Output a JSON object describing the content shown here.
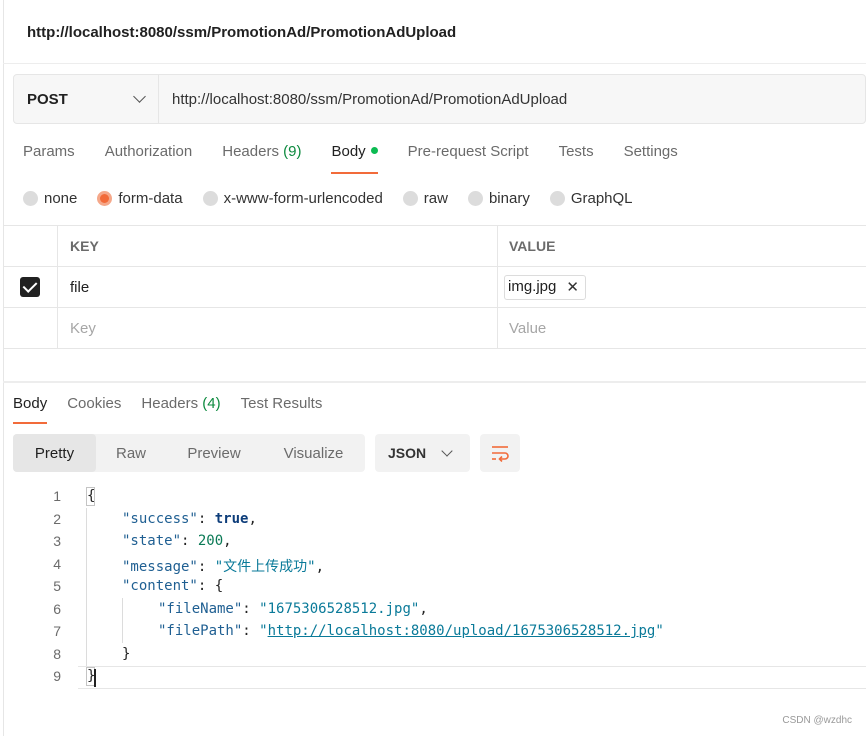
{
  "request_title": "http://localhost:8080/ssm/PromotionAd/PromotionAdUpload",
  "request": {
    "method": "POST",
    "url": "http://localhost:8080/ssm/PromotionAd/PromotionAdUpload"
  },
  "request_tabs": [
    {
      "label": "Params"
    },
    {
      "label": "Authorization"
    },
    {
      "label": "Headers",
      "count": "(9)"
    },
    {
      "label": "Body",
      "active": true
    },
    {
      "label": "Pre-request Script"
    },
    {
      "label": "Tests"
    },
    {
      "label": "Settings"
    }
  ],
  "body_types": [
    {
      "label": "none"
    },
    {
      "label": "form-data",
      "selected": true
    },
    {
      "label": "x-www-form-urlencoded"
    },
    {
      "label": "raw"
    },
    {
      "label": "binary"
    },
    {
      "label": "GraphQL"
    }
  ],
  "form_table": {
    "headers": {
      "key": "KEY",
      "value": "VALUE"
    },
    "rows": [
      {
        "checked": true,
        "key": "file",
        "value": "img.jpg"
      }
    ],
    "placeholder": {
      "key": "Key",
      "value": "Value"
    }
  },
  "response_tabs": [
    {
      "label": "Body",
      "active": true
    },
    {
      "label": "Cookies"
    },
    {
      "label": "Headers",
      "count": "(4)"
    },
    {
      "label": "Test Results"
    }
  ],
  "view_modes": [
    {
      "label": "Pretty",
      "active": true
    },
    {
      "label": "Raw"
    },
    {
      "label": "Preview"
    },
    {
      "label": "Visualize"
    }
  ],
  "format": "JSON",
  "line_numbers": [
    "1",
    "2",
    "3",
    "4",
    "5",
    "6",
    "7",
    "8",
    "9"
  ],
  "response_json": {
    "open_brace": "{",
    "success_key": "\"success\"",
    "success_val": "true",
    "state_key": "\"state\"",
    "state_val": "200",
    "message_key": "\"message\"",
    "message_val": "\"文件上传成功\"",
    "content_key": "\"content\"",
    "fileName_key": "\"fileName\"",
    "fileName_val": "\"1675306528512.jpg\"",
    "filePath_key": "\"filePath\"",
    "filePath_val": "http://localhost:8080/upload/1675306528512.jpg",
    "inner_close": "}",
    "close_brace": "}"
  },
  "watermark": "CSDN @wzdhc",
  "icons": {
    "method_dropdown": "chevron-down-icon",
    "format_dropdown": "chevron-down-icon",
    "remove_file": "close-icon",
    "wrap_lines": "wrap-lines-icon",
    "enabled": "checkbox-checked-icon"
  },
  "colors": {
    "accent": "#f26b3a",
    "count_green": "#0c8a3e",
    "body_dot": "#0cbb52"
  }
}
